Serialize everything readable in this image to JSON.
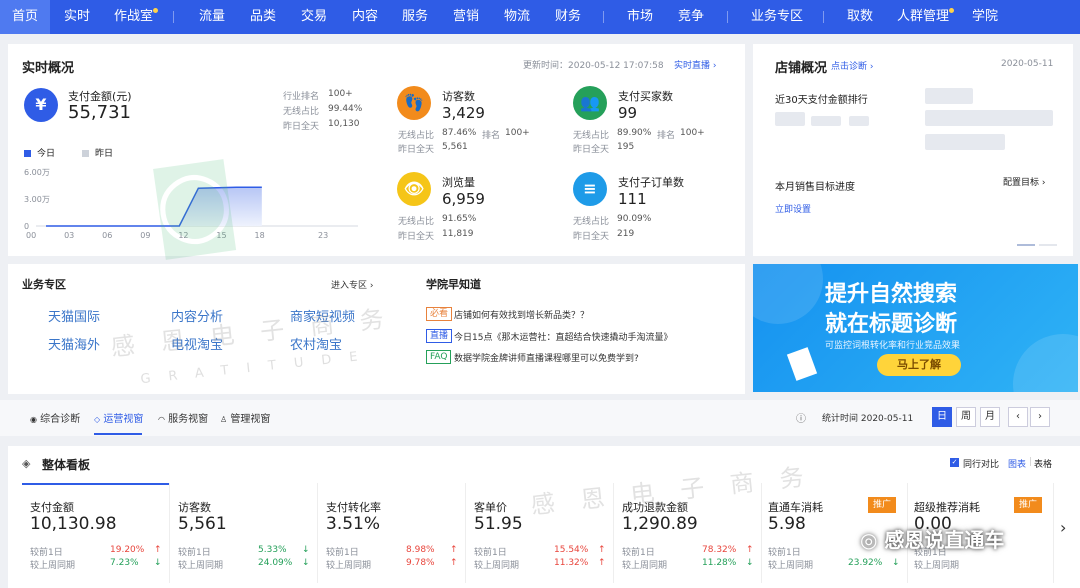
{
  "nav": {
    "items": [
      "首页",
      "实时",
      "作战室",
      "流量",
      "品类",
      "交易",
      "内容",
      "服务",
      "营销",
      "物流",
      "财务",
      "市场",
      "竞争",
      "业务专区",
      "取数",
      "人群管理",
      "学院"
    ]
  },
  "realtime": {
    "title": "实时概况",
    "update_time": "更新时间：2020-05-12 17:07:58",
    "live_link": "实时直播",
    "pay_label": "支付金额(元)",
    "pay_value": "55,731",
    "rank_label": "行业排名",
    "rank_value": "100+",
    "wireless_label": "无线占比",
    "wireless_value": "99.44%",
    "yesterday_label": "昨日全天",
    "yesterday_value": "10,130",
    "legend_today": "今日",
    "legend_yesterday": "昨日",
    "y_ticks": [
      "6.00万",
      "3.00万",
      "0"
    ],
    "x_ticks": [
      "00",
      "03",
      "06",
      "09",
      "12",
      "15",
      "18",
      "23"
    ],
    "visitors": {
      "label": "访客数",
      "value": "3,429",
      "wl": "无线占比",
      "wv": "87.46%",
      "rl": "排名",
      "rv": "100+",
      "yl": "昨日全天",
      "yv": "5,561"
    },
    "buyers": {
      "label": "支付买家数",
      "value": "99",
      "wl": "无线占比",
      "wv": "89.90%",
      "rl": "排名",
      "rv": "100+",
      "yl": "昨日全天",
      "yv": "195"
    },
    "views": {
      "label": "浏览量",
      "value": "6,959",
      "wl": "无线占比",
      "wv": "91.65%",
      "yl": "昨日全天",
      "yv": "11,819"
    },
    "orders": {
      "label": "支付子订单数",
      "value": "111",
      "wl": "无线占比",
      "wv": "90.09%",
      "yl": "昨日全天",
      "yv": "219"
    }
  },
  "chart_data": {
    "type": "area",
    "x": [
      "00",
      "03",
      "06",
      "09",
      "12",
      "15",
      "18",
      "23"
    ],
    "ylim": [
      0,
      60000
    ],
    "y_ticks": [
      "6.00万",
      "3.00万",
      "0"
    ],
    "series": [
      {
        "name": "今日",
        "points": [
          [
            0,
            0
          ],
          [
            3,
            0
          ],
          [
            6,
            0
          ],
          [
            9,
            0
          ],
          [
            10.5,
            0
          ],
          [
            12,
            42000
          ],
          [
            15,
            43000
          ],
          [
            17,
            43000
          ]
        ]
      }
    ]
  },
  "store": {
    "title": "店铺概况",
    "diag_link": "点击诊断",
    "date": "2020-05-11",
    "rank_label": "近30天支付金额排行",
    "target_label": "本月销售目标进度",
    "target_config": "配置目标",
    "set_now": "立即设置"
  },
  "biz": {
    "title": "业务专区",
    "enter_link": "进入专区",
    "links": [
      "天猫国际",
      "内容分析",
      "商家短视频",
      "天猫海外",
      "电视淘宝",
      "农村淘宝"
    ]
  },
  "academy": {
    "title": "学院早知道",
    "items": [
      {
        "tag": "必看",
        "text": "店铺如何有效找到增长新品类？？",
        "color": "#e8823c"
      },
      {
        "tag": "直播",
        "text": "今日15点《那木运营社：直超结合快速撬动手淘流量》",
        "color": "#2f5ce6"
      },
      {
        "tag": "FAQ",
        "text": "数据学院金牌讲师直播课程哪里可以免费学到?",
        "color": "#25a05a"
      }
    ]
  },
  "banner": {
    "line1": "提升自然搜索",
    "line2": "就在标题诊断",
    "sub": "可监控词根转化率和行业竞品效果",
    "button": "马上了解",
    "bg": "#1e8ce8"
  },
  "tabs": {
    "items": [
      "综合诊断",
      "运营视窗",
      "服务视窗",
      "管理视窗"
    ],
    "stat_time": "统计时间 2020-05-11",
    "periods": [
      "日",
      "周",
      "月"
    ],
    "prev": "‹",
    "next": "›"
  },
  "board": {
    "title": "整体看板",
    "peer_compare": "同行对比",
    "chart_link": "图表",
    "table_link": "表格",
    "next": "›",
    "metrics": [
      {
        "label": "支付金额",
        "value": "10,130.98",
        "r1": "较前1日",
        "p1": "19.20%",
        "d1": "up",
        "r2": "较上周同期",
        "p2": "7.23%",
        "d2": "down"
      },
      {
        "label": "访客数",
        "value": "5,561",
        "r1": "较前1日",
        "p1": "5.33%",
        "d1": "down",
        "r2": "较上周同期",
        "p2": "24.09%",
        "d2": "down"
      },
      {
        "label": "支付转化率",
        "value": "3.51%",
        "r1": "较前1日",
        "p1": "8.98%",
        "d1": "up",
        "r2": "较上周同期",
        "p2": "9.78%",
        "d2": "up"
      },
      {
        "label": "客单价",
        "value": "51.95",
        "r1": "较前1日",
        "p1": "15.54%",
        "d1": "up",
        "r2": "较上周同期",
        "p2": "11.32%",
        "d2": "up"
      },
      {
        "label": "成功退款金额",
        "value": "1,290.89",
        "r1": "较前1日",
        "p1": "78.32%",
        "d1": "up",
        "r2": "较上周同期",
        "p2": "11.28%",
        "d2": "down"
      },
      {
        "label": "直通车消耗",
        "value": "5.98",
        "r1": "较前1日",
        "p1": "",
        "d1": "",
        "r2": "较上周同期",
        "p2": "23.92%",
        "d2": "down",
        "promo": "推广"
      },
      {
        "label": "超级推荐消耗",
        "value": "0.00",
        "r1": "较前1日",
        "p1": "",
        "d1": "",
        "r2": "较上周同期",
        "p2": "",
        "d2": "",
        "promo": "推广"
      }
    ]
  },
  "watermark": {
    "text_cn": "感恩电子商务",
    "text_en": "GRATITUDE",
    "footer": "感恩说直通车"
  }
}
